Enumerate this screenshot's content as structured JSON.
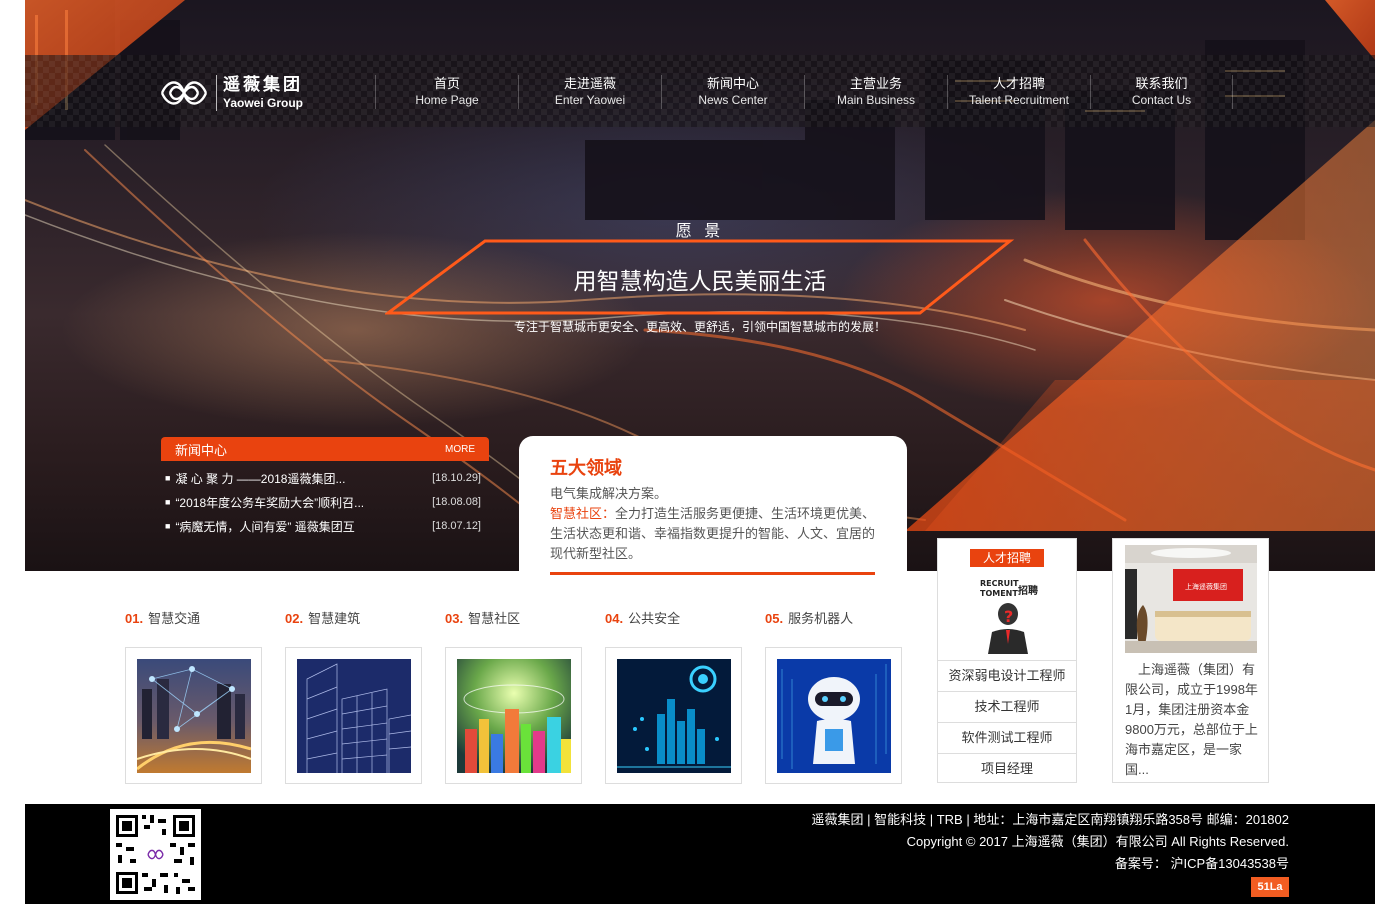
{
  "brand": {
    "name_cn": "遥薇集团",
    "name_en": "Yaowei Group"
  },
  "nav": {
    "items": [
      {
        "cn": "首页",
        "en": "Home Page"
      },
      {
        "cn": "走进遥薇",
        "en": "Enter Yaowei"
      },
      {
        "cn": "新闻中心",
        "en": "News Center"
      },
      {
        "cn": "主营业务",
        "en": "Main Business"
      },
      {
        "cn": "人才招聘",
        "en": "Talent Recruitment"
      },
      {
        "cn": "联系我们",
        "en": "Contact Us"
      }
    ]
  },
  "hero": {
    "vision_title": "愿 景",
    "vision_main": "用智慧构造人民美丽生活",
    "vision_sub": "专注于智慧城市更安全、更高效、更舒适，引领中国智慧城市的发展！"
  },
  "news": {
    "title": "新闻中心",
    "more": "MORE",
    "items": [
      {
        "title": "凝 心 聚 力 ——2018遥薇集团...",
        "date": "[18.10.29]"
      },
      {
        "title": "“2018年度公务车奖励大会”顺利召...",
        "date": "[18.08.08]"
      },
      {
        "title": "“病魔无情，人间有爱” 遥薇集团互",
        "date": "[18.07.12]"
      }
    ]
  },
  "fields": {
    "title": "五大领域",
    "line1": "电气集成解决方案。",
    "highlight": "智慧社区：",
    "line2": "全力打造生活服务更便捷、生活环境更优美、生活状态更和谐、幸福指数更提升的智能、人文、宜居的现代新型社区。"
  },
  "services": [
    {
      "num": "01.",
      "label": "智慧交通"
    },
    {
      "num": "02.",
      "label": "智慧建筑"
    },
    {
      "num": "03.",
      "label": "智慧社区"
    },
    {
      "num": "04.",
      "label": "公共安全"
    },
    {
      "num": "05.",
      "label": "服务机器人"
    }
  ],
  "recruit": {
    "tag": "人才招聘",
    "img_text_1": "RECRUIT",
    "img_text_2": "TOMENT",
    "img_text_3": "招聘",
    "positions": [
      "资深弱电设计工程师",
      "技术工程师",
      "软件测试工程师",
      "项目经理"
    ]
  },
  "company": {
    "sign": "上海遥薇集团",
    "text": "上海遥薇（集团）有限公司，成立于1998年1月，集团注册资本金9800万元，总部位于上海市嘉定区，是一家国..."
  },
  "footer": {
    "links_line": "遥薇集团 | 智能科技 | TRB | 地址：上海市嘉定区南翔镇翔乐路358号 邮编：201802",
    "copyright": "Copyright © 2017 上海遥薇（集团）有限公司 All Rights Reserved.",
    "icp": "备案号： 沪ICP备13043538号",
    "badge": "51La"
  },
  "colors": {
    "accent": "#e9430f",
    "footer_bg": "#000000",
    "badge": "#f25d22"
  }
}
